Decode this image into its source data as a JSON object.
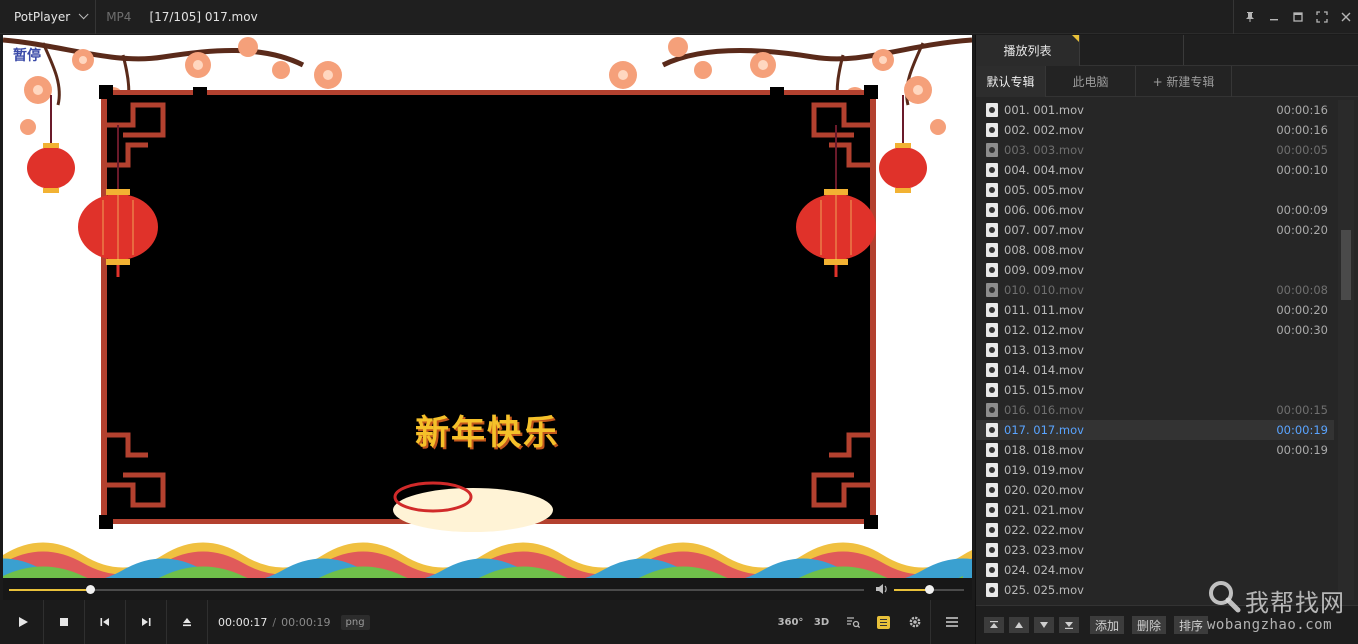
{
  "titlebar": {
    "app_name": "PotPlayer",
    "format": "MP4",
    "title": "[17/105] 017.mov"
  },
  "video": {
    "osd_text": "暂停",
    "center_caption": "新年快乐"
  },
  "player": {
    "position_fraction": 0.0947,
    "volume_fraction": 0.5,
    "time_current": "00:00:17",
    "time_separator": "/",
    "time_total": "00:00:19",
    "badge": "png",
    "btn_360": "360°",
    "btn_3d": "3D"
  },
  "playlist": {
    "tab": "播放列表",
    "subtabs": [
      "默认专辑",
      "此电脑",
      "+ 新建专辑"
    ],
    "items": [
      {
        "name": "001. 001.mov",
        "duration": "00:00:16",
        "state": "normal"
      },
      {
        "name": "002. 002.mov",
        "duration": "00:00:16",
        "state": "normal"
      },
      {
        "name": "003. 003.mov",
        "duration": "00:00:05",
        "state": "dim"
      },
      {
        "name": "004. 004.mov",
        "duration": "00:00:10",
        "state": "normal"
      },
      {
        "name": "005. 005.mov",
        "duration": "",
        "state": "normal"
      },
      {
        "name": "006. 006.mov",
        "duration": "00:00:09",
        "state": "normal"
      },
      {
        "name": "007. 007.mov",
        "duration": "00:00:20",
        "state": "normal"
      },
      {
        "name": "008. 008.mov",
        "duration": "",
        "state": "normal"
      },
      {
        "name": "009. 009.mov",
        "duration": "",
        "state": "normal"
      },
      {
        "name": "010. 010.mov",
        "duration": "00:00:08",
        "state": "dim"
      },
      {
        "name": "011. 011.mov",
        "duration": "00:00:20",
        "state": "normal"
      },
      {
        "name": "012. 012.mov",
        "duration": "00:00:30",
        "state": "normal"
      },
      {
        "name": "013. 013.mov",
        "duration": "",
        "state": "normal"
      },
      {
        "name": "014. 014.mov",
        "duration": "",
        "state": "normal"
      },
      {
        "name": "015. 015.mov",
        "duration": "",
        "state": "normal"
      },
      {
        "name": "016. 016.mov",
        "duration": "00:00:15",
        "state": "dim"
      },
      {
        "name": "017. 017.mov",
        "duration": "00:00:19",
        "state": "current"
      },
      {
        "name": "018. 018.mov",
        "duration": "00:00:19",
        "state": "normal"
      },
      {
        "name": "019. 019.mov",
        "duration": "",
        "state": "normal"
      },
      {
        "name": "020. 020.mov",
        "duration": "",
        "state": "normal"
      },
      {
        "name": "021. 021.mov",
        "duration": "",
        "state": "normal"
      },
      {
        "name": "022. 022.mov",
        "duration": "",
        "state": "normal"
      },
      {
        "name": "023. 023.mov",
        "duration": "",
        "state": "normal"
      },
      {
        "name": "024. 024.mov",
        "duration": "",
        "state": "normal"
      },
      {
        "name": "025. 025.mov",
        "duration": "",
        "state": "normal"
      }
    ],
    "buttons": {
      "add": "添加",
      "delete": "删除",
      "sort": "排序"
    }
  },
  "watermark": {
    "top": "我帮找网",
    "bottom": "wobangzhao.com"
  },
  "colors": {
    "accent": "#e8c13a",
    "current_item": "#5aa4ff",
    "frame_red": "#b3412f",
    "lantern_red": "#e0322a"
  }
}
